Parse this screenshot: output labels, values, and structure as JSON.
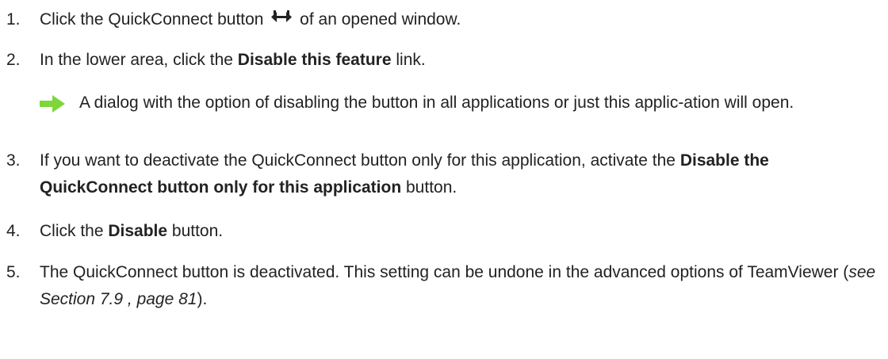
{
  "steps": [
    {
      "number": "1.",
      "before": "Click the QuickConnect button",
      "icon": "quickconnect-double-arrow-icon",
      "after": "of an opened window."
    },
    {
      "number": "2.",
      "before": "In the lower area, click the ",
      "bold": "Disable this feature",
      "after": " link."
    },
    {
      "result_icon": "green-arrow-right-icon",
      "result_text": "A dialog with the option of disabling the button in all applications or just this applic-ation will open."
    },
    {
      "number": "3.",
      "before": "If you want to deactivate the QuickConnect button only for this application, activate the ",
      "bold": "Disable the QuickConnect button only for this application",
      "after": " button."
    },
    {
      "number": "4.",
      "before": "Click the ",
      "bold": "Disable",
      "after": " button."
    },
    {
      "number": "5.",
      "before": "The QuickConnect button is deactivated. This setting can be undone in the advanced options of TeamViewer (",
      "italic": "see Section 7.9 , page 81",
      "after": ")."
    }
  ],
  "colors": {
    "text": "#222222",
    "arrow_green": "#7DD63A"
  }
}
